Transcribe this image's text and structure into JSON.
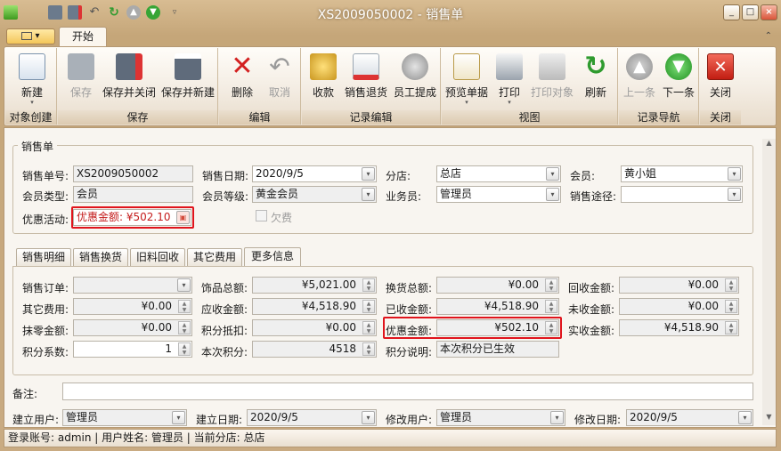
{
  "window": {
    "title": "XS2009050002 - 销售单",
    "controls": [
      "_",
      "□",
      "×"
    ]
  },
  "quick_access": [
    "app-icon",
    "save-icon",
    "save-close-icon",
    "undo-icon",
    "refresh-icon",
    "up-icon",
    "down-icon",
    "customize-icon"
  ],
  "ribbon": {
    "menu_label": "▾",
    "tab": "开始",
    "groups": [
      {
        "label": "对象创建"
      },
      {
        "label": "保存"
      },
      {
        "label": "编辑"
      },
      {
        "label": "记录编辑"
      },
      {
        "label": "视图"
      },
      {
        "label": "记录导航"
      },
      {
        "label": "关闭"
      }
    ],
    "buttons": {
      "new": "新建",
      "save": "保存",
      "save_close": "保存并关闭",
      "save_new": "保存并新建",
      "delete": "删除",
      "cancel": "取消",
      "receive": "收款",
      "return": "销售退货",
      "commission": "员工提成",
      "preview": "预览单据",
      "print": "打印",
      "print_obj": "打印对象",
      "refresh": "刷新",
      "prev": "上一条",
      "next": "下一条",
      "close": "关闭"
    }
  },
  "header": {
    "section": "销售单",
    "order_no_label": "销售单号:",
    "order_no": "XS2009050002",
    "date_label": "销售日期:",
    "date": "2020/9/5",
    "branch_label": "分店:",
    "branch": "总店",
    "member_label": "会员:",
    "member": "黄小姐",
    "member_type_label": "会员类型:",
    "member_type": "会员",
    "member_level_label": "会员等级:",
    "member_level": "黄金会员",
    "salesman_label": "业务员:",
    "salesman": "管理员",
    "channel_label": "销售途径:",
    "channel": "",
    "promo_label": "优惠活动:",
    "promo": "优惠金额: ¥502.10",
    "owe_label": "欠费"
  },
  "tabs": [
    "销售明细",
    "销售换货",
    "旧料回收",
    "其它费用",
    "更多信息"
  ],
  "more": {
    "so_label": "销售订单:",
    "so": "",
    "other_fee_label": "其它费用:",
    "other_fee": "¥0.00",
    "round_label": "抹零金额:",
    "round": "¥0.00",
    "coef_label": "积分系数:",
    "coef": "1",
    "total_label": "饰品总额:",
    "total": "¥5,021.00",
    "receivable_label": "应收金额:",
    "receivable": "¥4,518.90",
    "deduct_label": "积分抵扣:",
    "deduct": "¥0.00",
    "points_label": "本次积分:",
    "points": "4518",
    "exchange_label": "换货总额:",
    "exchange": "¥0.00",
    "received_label": "已收金额:",
    "received": "¥4,518.90",
    "discount_label": "优惠金额:",
    "discount": "¥502.10",
    "points_note_label": "积分说明:",
    "points_note": "本次积分已生效",
    "recycle_label": "回收金额:",
    "recycle": "¥0.00",
    "unreceived_label": "未收金额:",
    "unreceived": "¥0.00",
    "actual_label": "实收金额:",
    "actual": "¥4,518.90"
  },
  "footer": {
    "remark_label": "备注:",
    "remark": "",
    "creator_label": "建立用户:",
    "creator": "管理员",
    "create_date_label": "建立日期:",
    "create_date": "2020/9/5",
    "modifier_label": "修改用户:",
    "modifier": "管理员",
    "modify_date_label": "修改日期:",
    "modify_date": "2020/9/5"
  },
  "status": "登录账号: admin  |  用户姓名: 管理员  |  当前分店: 总店",
  "colors": {
    "highlight": "#e0141c",
    "accent": "#c9ab82"
  }
}
